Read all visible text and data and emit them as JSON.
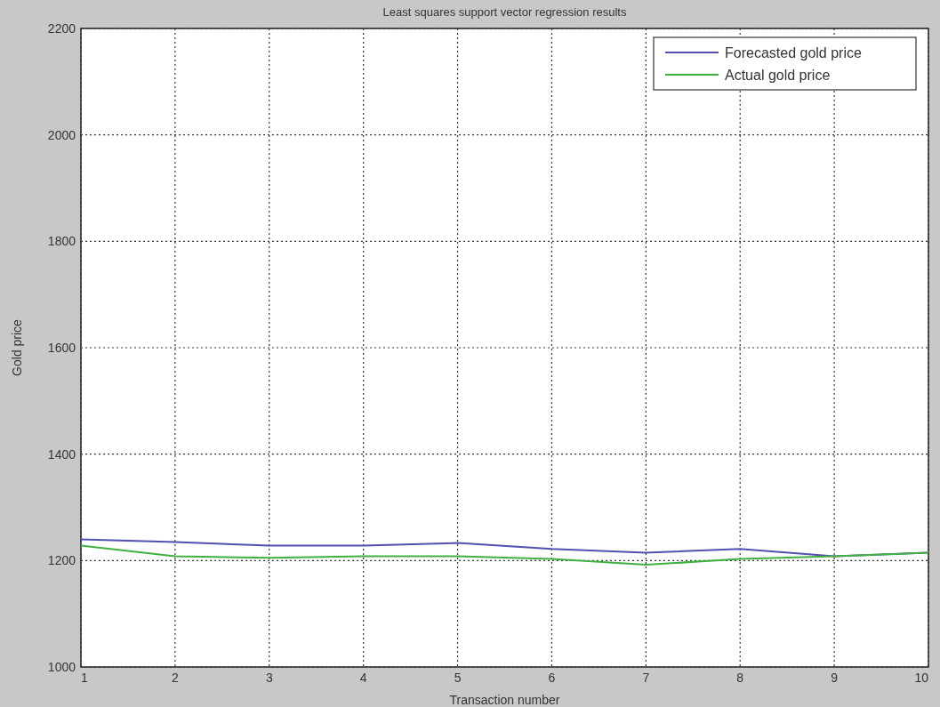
{
  "window": {
    "chart_data": {
      "type": "line",
      "title": "Least squares support vector regression results",
      "xlabel": "Transaction number",
      "ylabel": "Gold price",
      "x": [
        1,
        2,
        3,
        4,
        5,
        6,
        7,
        8,
        9,
        10
      ],
      "series": [
        {
          "name": "Forecasted gold price",
          "color": "#5050b0",
          "values": [
            1240,
            1235,
            1228,
            1228,
            1233,
            1222,
            1215,
            1222,
            1208,
            1215
          ]
        },
        {
          "name": "Actual gold price",
          "color": "#40b040",
          "values": [
            1228,
            1208,
            1205,
            1208,
            1208,
            1203,
            1192,
            1203,
            1208,
            1215
          ]
        }
      ],
      "xlim": [
        1,
        10
      ],
      "ylim": [
        1000,
        2200
      ],
      "xticks": [
        1,
        2,
        3,
        4,
        5,
        6,
        7,
        8,
        9,
        10
      ],
      "yticks": [
        1000,
        1200,
        1400,
        1600,
        1800,
        2000,
        2200
      ],
      "grid": true,
      "legend": true
    }
  }
}
